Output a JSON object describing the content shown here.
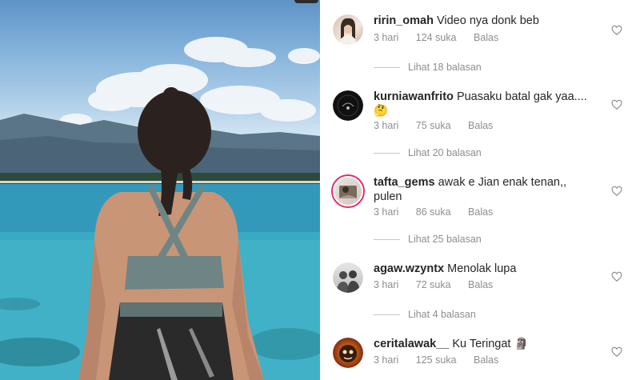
{
  "comments": [
    {
      "username": "ririn_omah",
      "text": "Video nya donk beb",
      "time": "3 hari",
      "likes": "124 suka",
      "reply_label": "Balas",
      "view_replies": "Lihat 18 balasan",
      "heart_icon": "heart-outline-icon"
    },
    {
      "username": "kurniawanfrito",
      "text": "Puasaku batal gak yaa....",
      "emoji": "🤔",
      "time": "3 hari",
      "likes": "75 suka",
      "reply_label": "Balas",
      "view_replies": "Lihat 20 balasan",
      "heart_icon": "heart-outline-icon"
    },
    {
      "username": "tafta_gems",
      "text": "awak e Jian enak tenan,,",
      "text_line2": "pulen",
      "time": "3 hari",
      "likes": "86 suka",
      "reply_label": "Balas",
      "view_replies": "Lihat 25 balasan",
      "heart_icon": "heart-outline-icon"
    },
    {
      "username": "agaw.wzyntx",
      "text": "Menolak lupa",
      "time": "3 hari",
      "likes": "72 suka",
      "reply_label": "Balas",
      "view_replies": "Lihat 4 balasan",
      "heart_icon": "heart-outline-icon"
    },
    {
      "username": "ceritalawak__",
      "text": "Ku Teringat",
      "emoji": "🗿",
      "time": "3 hari",
      "likes": "125 suka",
      "reply_label": "Balas",
      "heart_icon": "heart-outline-icon"
    }
  ],
  "colors": {
    "text": "#262626",
    "meta": "#8e8e8e",
    "story_ring": "#e1306c"
  }
}
